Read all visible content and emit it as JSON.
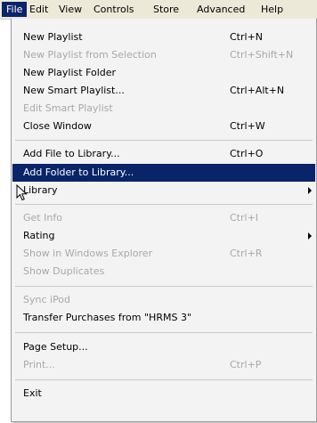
{
  "menubar": {
    "items": [
      "File",
      "Edit",
      "View",
      "Controls",
      "Store",
      "Advanced",
      "Help"
    ]
  },
  "menu": {
    "items": [
      {
        "label": "New Playlist",
        "shortcut": "Ctrl+N",
        "disabled": false
      },
      {
        "label": "New Playlist from Selection",
        "shortcut": "Ctrl+Shift+N",
        "disabled": true
      },
      {
        "label": "New Playlist Folder",
        "shortcut": "",
        "disabled": false
      },
      {
        "label": "New Smart Playlist...",
        "shortcut": "Ctrl+Alt+N",
        "disabled": false
      },
      {
        "label": "Edit Smart Playlist",
        "shortcut": "",
        "disabled": true
      },
      {
        "label": "Close Window",
        "shortcut": "Ctrl+W",
        "disabled": false
      },
      {
        "label": "Add File to Library...",
        "shortcut": "Ctrl+O",
        "disabled": false
      },
      {
        "label": "Add Folder to Library...",
        "shortcut": "",
        "disabled": false,
        "highlighted": true
      },
      {
        "label": "Library",
        "shortcut": "",
        "disabled": false,
        "submenu": true
      },
      {
        "label": "Get Info",
        "shortcut": "Ctrl+I",
        "disabled": true
      },
      {
        "label": "Rating",
        "shortcut": "",
        "disabled": false,
        "submenu": true
      },
      {
        "label": "Show in Windows Explorer",
        "shortcut": "Ctrl+R",
        "disabled": true
      },
      {
        "label": "Show Duplicates",
        "shortcut": "",
        "disabled": true
      },
      {
        "label": "Sync iPod",
        "shortcut": "",
        "disabled": true
      },
      {
        "label": "Transfer Purchases from \"HRMS 3\"",
        "shortcut": "",
        "disabled": false
      },
      {
        "label": "Page Setup...",
        "shortcut": "",
        "disabled": false
      },
      {
        "label": "Print...",
        "shortcut": "Ctrl+P",
        "disabled": true
      },
      {
        "label": "Exit",
        "shortcut": "",
        "disabled": false
      }
    ]
  },
  "colors": {
    "highlight": "#0a246a",
    "disabled_text": "#a8a8a8",
    "menu_bg": "#f3f3f3",
    "menubar_bg": "#ece9d8"
  }
}
